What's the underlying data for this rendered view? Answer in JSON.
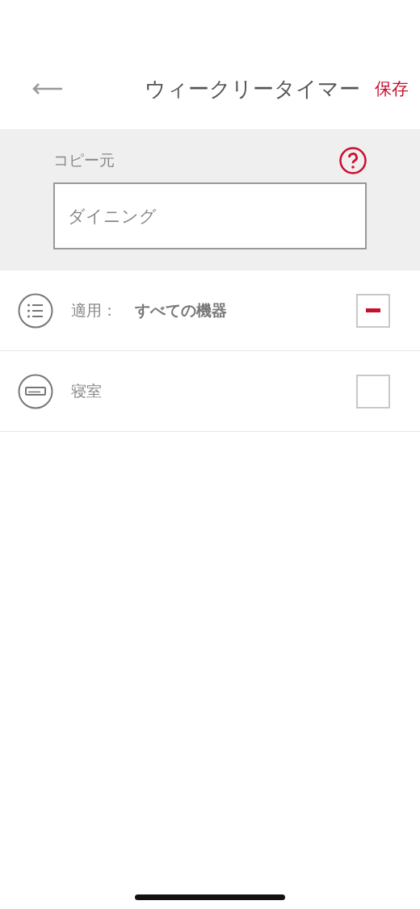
{
  "header": {
    "title": "ウィークリータイマー",
    "save": "保存"
  },
  "copy_source": {
    "label": "コピー元",
    "value": "ダイニング"
  },
  "rows": [
    {
      "kind": "all",
      "label": "適用：",
      "value": "すべての機器",
      "checked": false,
      "indeterminate": true
    },
    {
      "kind": "device",
      "label": "寝室",
      "checked": false,
      "indeterminate": false
    }
  ]
}
